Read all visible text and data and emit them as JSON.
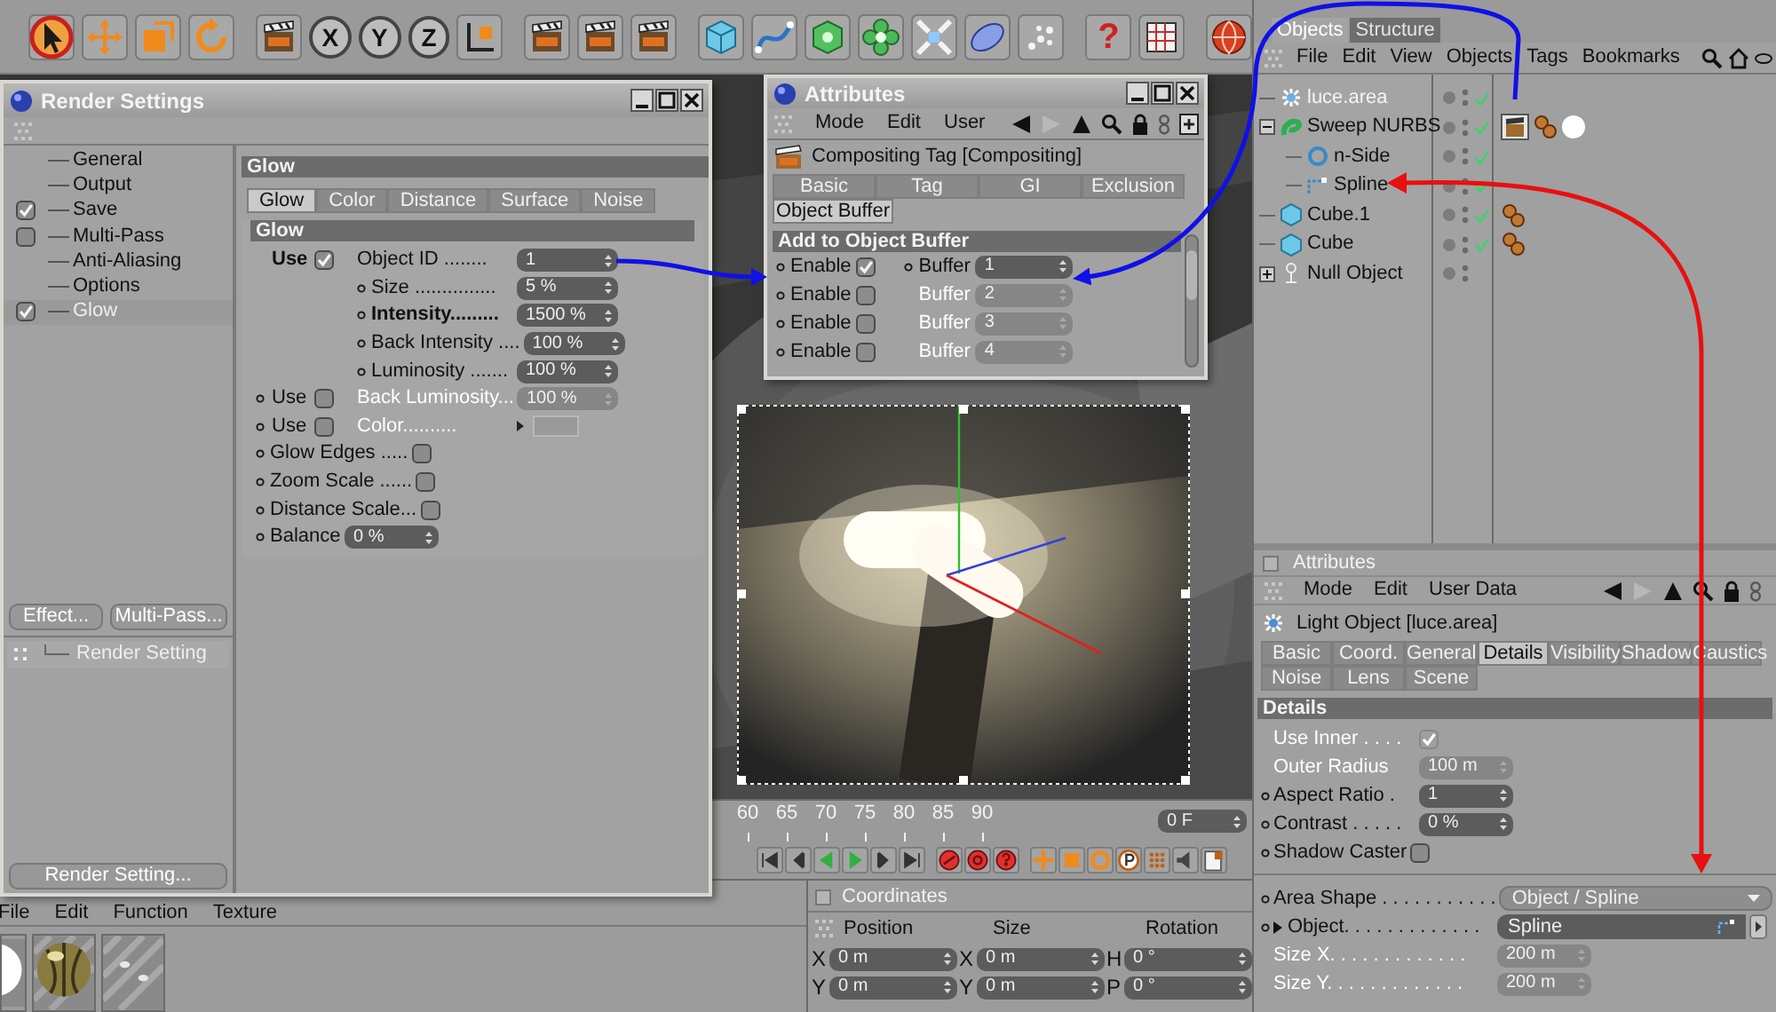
{
  "toolbar": {
    "tools": [
      {
        "selected": true
      },
      {
        "selected": false
      },
      {
        "selected": false
      },
      {
        "selected": false
      }
    ],
    "axes": [
      "X",
      "Y",
      "Z"
    ],
    "help": "?"
  },
  "render_settings": {
    "title": "Render Settings",
    "sidebar": [
      {
        "label": "General",
        "kind": "plain",
        "selected": false
      },
      {
        "label": "Output",
        "kind": "plain",
        "selected": false
      },
      {
        "label": "Save",
        "kind": "check",
        "checked": true,
        "selected": false
      },
      {
        "label": "Multi-Pass",
        "kind": "check",
        "checked": false,
        "selected": false
      },
      {
        "label": "Anti-Aliasing",
        "kind": "plain",
        "selected": false
      },
      {
        "label": "Options",
        "kind": "plain",
        "selected": false
      },
      {
        "label": "Glow",
        "kind": "check",
        "checked": true,
        "selected": true
      }
    ],
    "buttons": [
      "Effect...",
      "Multi-Pass..."
    ],
    "tree": [
      {
        "label": "Render Setting"
      }
    ],
    "footer_button": "Render Setting...",
    "heading": "Glow",
    "tabs": [
      {
        "label": "Glow",
        "selected": true
      },
      {
        "label": "Color",
        "selected": false
      },
      {
        "label": "Distance",
        "selected": false
      },
      {
        "label": "Surface",
        "selected": false
      },
      {
        "label": "Noise",
        "selected": false
      }
    ],
    "section": "Glow",
    "rows": [
      {
        "kind": "sub_number",
        "use": {
          "label": "Use",
          "bold": true,
          "dot": false,
          "checked": true
        },
        "dot": false,
        "bold": false,
        "disabled": false,
        "label": "Object ID ........",
        "value": "1"
      },
      {
        "kind": "sub_number",
        "dot": true,
        "bold": false,
        "disabled": false,
        "label": "Size ...............",
        "value": "5 %"
      },
      {
        "kind": "sub_number",
        "dot": true,
        "bold": true,
        "disabled": false,
        "label": "Intensity.........",
        "value": "1500 %"
      },
      {
        "kind": "sub_number",
        "dot": true,
        "bold": false,
        "disabled": false,
        "label": "Back Intensity ....",
        "value": "100 %"
      },
      {
        "kind": "sub_number",
        "dot": true,
        "bold": false,
        "disabled": false,
        "label": "Luminosity .......",
        "value": "100 %"
      },
      {
        "kind": "sub_number",
        "use": {
          "label": "Use",
          "bold": false,
          "dot": true,
          "checked": false
        },
        "dot": false,
        "bold": false,
        "disabled": true,
        "label": "Back Luminosity...",
        "value": "100 %"
      },
      {
        "kind": "sub_color",
        "use": {
          "label": "Use",
          "bold": false,
          "dot": true,
          "checked": false
        },
        "dot": false,
        "bold": false,
        "disabled": true,
        "label": "Color.........."
      },
      {
        "kind": "check",
        "dot": true,
        "bold": false,
        "disabled": false,
        "label": "Glow Edges .....",
        "checked": false
      },
      {
        "kind": "check",
        "dot": true,
        "bold": false,
        "disabled": false,
        "label": "Zoom Scale ......",
        "checked": false
      },
      {
        "kind": "check",
        "dot": true,
        "bold": false,
        "disabled": false,
        "label": "Distance Scale...",
        "checked": false
      },
      {
        "kind": "number",
        "dot": true,
        "bold": false,
        "disabled": false,
        "label": "Balance",
        "value": "0 %"
      }
    ]
  },
  "attributes_window": {
    "title": "Attributes",
    "menu": [
      "Mode",
      "Edit",
      "User"
    ],
    "header": "Compositing Tag [Compositing]",
    "tabs": [
      {
        "label": "Basic",
        "selected": false
      },
      {
        "label": "Tag",
        "selected": false
      },
      {
        "label": "GI",
        "selected": false
      },
      {
        "label": "Exclusion",
        "selected": false
      },
      {
        "label": "Object Buffer",
        "selected": true
      }
    ],
    "section": "Add to Object Buffer",
    "rows": [
      {
        "enable": "Enable",
        "checked": true,
        "buffer": "Buffer",
        "value": "1"
      },
      {
        "enable": "Enable",
        "checked": false,
        "buffer": "Buffer",
        "value": "2"
      },
      {
        "enable": "Enable",
        "checked": false,
        "buffer": "Buffer",
        "value": "3"
      },
      {
        "enable": "Enable",
        "checked": false,
        "buffer": "Buffer",
        "value": "4"
      }
    ]
  },
  "objects": {
    "tabs": [
      {
        "label": "Objects",
        "selected": true
      },
      {
        "label": "Structure",
        "selected": false
      }
    ],
    "menu": [
      "File",
      "Edit",
      "View",
      "Objects",
      "Tags",
      "Bookmarks"
    ],
    "tree": [
      {
        "label": "luce.area",
        "kind": "light",
        "selected": true,
        "enabled": true
      },
      {
        "label": "Sweep NURBS",
        "kind": "sweep",
        "selected": false,
        "enabled": true,
        "expanded": true,
        "children": [
          {
            "label": "n-Side",
            "kind": "nside",
            "selected": false,
            "enabled": true
          },
          {
            "label": "Spline",
            "kind": "spline",
            "selected": false,
            "enabled": true
          }
        ]
      },
      {
        "label": "Cube.1",
        "kind": "cube",
        "selected": false,
        "enabled": true
      },
      {
        "label": "Cube",
        "kind": "cube",
        "selected": false,
        "enabled": true
      },
      {
        "label": "Null Object",
        "kind": "null",
        "selected": false,
        "enabled": false,
        "expanded": false
      }
    ]
  },
  "attributes": {
    "title": "Attributes",
    "menu": [
      "Mode",
      "Edit",
      "User Data"
    ],
    "header": "Light Object [luce.area]",
    "tab_rows": [
      {
        "tabs": [
          {
            "label": "Basic",
            "selected": false
          },
          {
            "label": "Coord.",
            "selected": false
          },
          {
            "label": "General",
            "selected": false
          },
          {
            "label": "Details",
            "selected": true
          },
          {
            "label": "Visibility",
            "selected": false
          },
          {
            "label": "Shadow",
            "selected": false
          },
          {
            "label": "Caustics",
            "selected": false
          }
        ]
      },
      {
        "tabs": [
          {
            "label": "Noise",
            "selected": false
          },
          {
            "label": "Lens",
            "selected": false
          },
          {
            "label": "Scene",
            "selected": false
          }
        ]
      }
    ],
    "section": "Details",
    "groups": [
      {
        "rows": [
          {
            "kind": "check",
            "dot": false,
            "label": "Use Inner . . . .",
            "checked": true,
            "disabled": true
          },
          {
            "kind": "number",
            "dot": false,
            "label": "Outer Radius",
            "value": "100 m",
            "disabled": true
          },
          {
            "kind": "number",
            "dot": true,
            "label": "Aspect Ratio .",
            "value": "1",
            "disabled": false
          },
          {
            "kind": "number",
            "dot": true,
            "label": "Contrast . . . . .",
            "value": "0 %",
            "disabled": false
          },
          {
            "kind": "check",
            "dot": true,
            "label": "Shadow Caster",
            "checked": false,
            "disabled": false
          }
        ]
      },
      {
        "rows": [
          {
            "kind": "dropdown",
            "dot": true,
            "label": "Area Shape . . . . . . . . . . .",
            "value": "Object / Spline",
            "disabled": false
          },
          {
            "kind": "link",
            "dot": true,
            "label": "Object. . . . . . . . . . . . .",
            "value": "Spline",
            "disabled": false
          },
          {
            "kind": "number",
            "dot": false,
            "label": "Size X. . . . . . . . . . . . .",
            "value": "200 m",
            "disabled": true
          },
          {
            "kind": "number",
            "dot": false,
            "label": "Size Y. . . . . . . . . . . . .",
            "value": "200 m",
            "disabled": true
          }
        ]
      }
    ]
  },
  "timeline": {
    "ticks": [
      "60",
      "65",
      "70",
      "75",
      "80",
      "85",
      "90"
    ],
    "frame": "0 F"
  },
  "materials": {
    "menu": [
      "File",
      "Edit",
      "Function",
      "Texture"
    ]
  },
  "coordinates": {
    "title": "Coordinates",
    "columns": [
      "Position",
      "Size",
      "Rotation"
    ],
    "rows": [
      {
        "cells": [
          {
            "axis": "X",
            "value": "0 m"
          },
          {
            "axis": "X",
            "value": "0 m"
          },
          {
            "axis": "H",
            "value": "0 °"
          }
        ]
      },
      {
        "cells": [
          {
            "axis": "Y",
            "value": "0 m"
          },
          {
            "axis": "Y",
            "value": "0 m"
          },
          {
            "axis": "P",
            "value": "0 °"
          }
        ]
      }
    ]
  }
}
